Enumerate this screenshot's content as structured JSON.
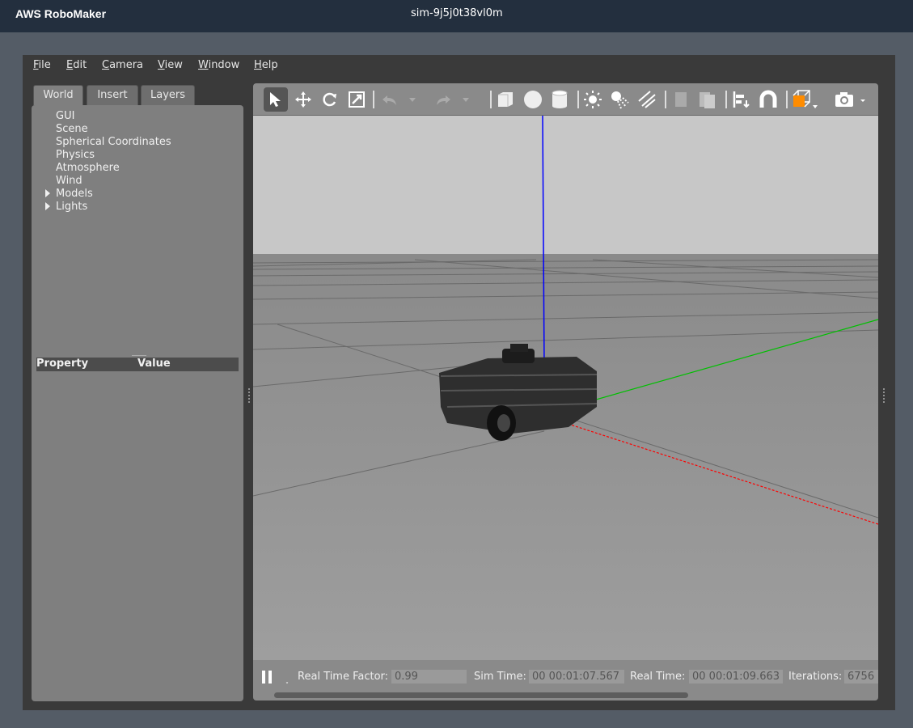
{
  "app": {
    "brand": "AWS RoboMaker",
    "sim_id": "sim-9j5j0t38vl0m"
  },
  "menubar": [
    {
      "first": "F",
      "rest": "ile"
    },
    {
      "first": "E",
      "rest": "dit"
    },
    {
      "first": "C",
      "rest": "amera"
    },
    {
      "first": "V",
      "rest": "iew"
    },
    {
      "first": "W",
      "rest": "indow"
    },
    {
      "first": "H",
      "rest": "elp"
    }
  ],
  "tabs": [
    "World",
    "Insert",
    "Layers"
  ],
  "world_tree": {
    "items": [
      "GUI",
      "Scene",
      "Spherical Coordinates",
      "Physics",
      "Atmosphere",
      "Wind"
    ],
    "expandable": [
      "Models",
      "Lights"
    ]
  },
  "property_table": {
    "property_header": "Property",
    "value_header": "Value"
  },
  "toolbar_icons": [
    "select-arrow-icon",
    "translate-icon",
    "rotate-icon",
    "scale-icon",
    "undo-icon",
    "redo-icon",
    "box-icon",
    "sphere-icon",
    "cylinder-icon",
    "point-light-icon",
    "spot-light-icon",
    "directional-light-icon",
    "copy-icon",
    "paste-icon",
    "align-icon",
    "snap-icon",
    "view-angle-icon",
    "screenshot-icon"
  ],
  "status": {
    "rtf_label": "Real Time Factor:",
    "rtf_value": "0.99",
    "sim_time_label": "Sim Time:",
    "sim_time_value": "00 00:01:07.567",
    "real_time_label": "Real Time:",
    "real_time_value": "00 00:01:09.663",
    "iterations_label": "Iterations:",
    "iterations_value": "6756"
  },
  "colors": {
    "top_bar": "#232f3e",
    "z_axis": "#0000ff",
    "y_axis": "#00c000",
    "x_axis": "#ff0000",
    "accent_orange": "#ff8c00"
  }
}
